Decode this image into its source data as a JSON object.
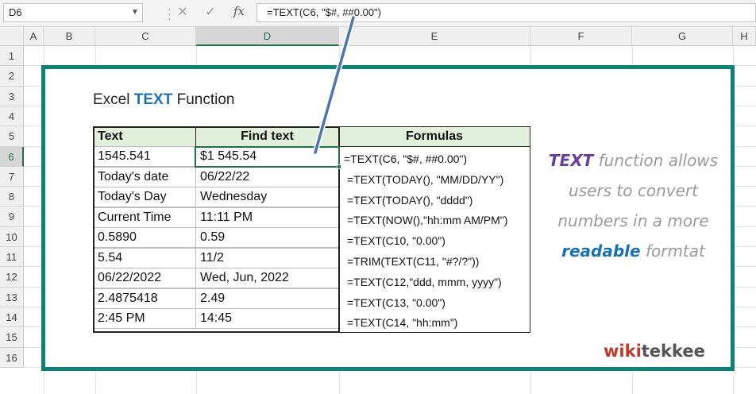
{
  "formula_bar": {
    "name_box": "D6",
    "cancel_icon": "✕",
    "enter_icon": "✓",
    "fx_label": "fx",
    "formula": "=TEXT(C6, \"$#, ##0.00\")"
  },
  "columns": [
    "A",
    "B",
    "C",
    "D",
    "E",
    "F",
    "G",
    "H"
  ],
  "rows": [
    "1",
    "2",
    "3",
    "4",
    "5",
    "6",
    "7",
    "8",
    "9",
    "10",
    "11",
    "12",
    "13",
    "14",
    "15",
    "16"
  ],
  "selection": {
    "column": "D",
    "row": "6"
  },
  "sheet": {
    "title_prefix": "Excel ",
    "title_keyword": "TEXT",
    "title_suffix": " Function",
    "headers": {
      "text": "Text",
      "find_text": "Find text",
      "formulas": "Formulas"
    },
    "rows": [
      {
        "text": "1545.541",
        "result": "$1 545.54",
        "formula": "=TEXT(C6, \"$#, ##0.00\")"
      },
      {
        "text": "Today's date",
        "result": "06/22/22",
        "formula": "=TEXT(TODAY(), \"MM/DD/YY\")"
      },
      {
        "text": "Today's Day",
        "result": "Wednesday",
        "formula": "=TEXT(TODAY(), \"dddd\")"
      },
      {
        "text": "Current Time",
        "result": "11:11 PM",
        "formula": "=TEXT(NOW(),\"hh:mm AM/PM\")"
      },
      {
        "text": "0.5890",
        "result": "0.59",
        "formula": "=TEXT(C10, \"0.00\")"
      },
      {
        "text": "5.54",
        "result": "11/2",
        "formula": "=TRIM(TEXT(C11, \"#?/?\"))"
      },
      {
        "text": "06/22/2022",
        "result": "Wed, Jun, 2022",
        "formula": "=TEXT(C12,\"ddd, mmm, yyyy\")"
      },
      {
        "text": "2.4875418",
        "result": "2.49",
        "formula": "=TEXT(C13, \"0.00\")"
      },
      {
        "text": "2:45 PM",
        "result": "14:45",
        "formula": "=TEXT(C14, \"hh:mm\")"
      }
    ]
  },
  "side_note": {
    "line1_kw": "TEXT",
    "line1_rest": " function allows",
    "line2": "users to convert",
    "line3": "numbers in a more",
    "line4_kw": "readable",
    "line4_rest": " formtat"
  },
  "logo": {
    "part1": "wiki",
    "part2": "tekkee"
  },
  "colors": {
    "accent_green": "#217346",
    "frame_teal": "#0f8076",
    "header_fill": "#e2efda",
    "keyword_purple": "#6a3d9a",
    "keyword_blue": "#1a6fb5"
  }
}
